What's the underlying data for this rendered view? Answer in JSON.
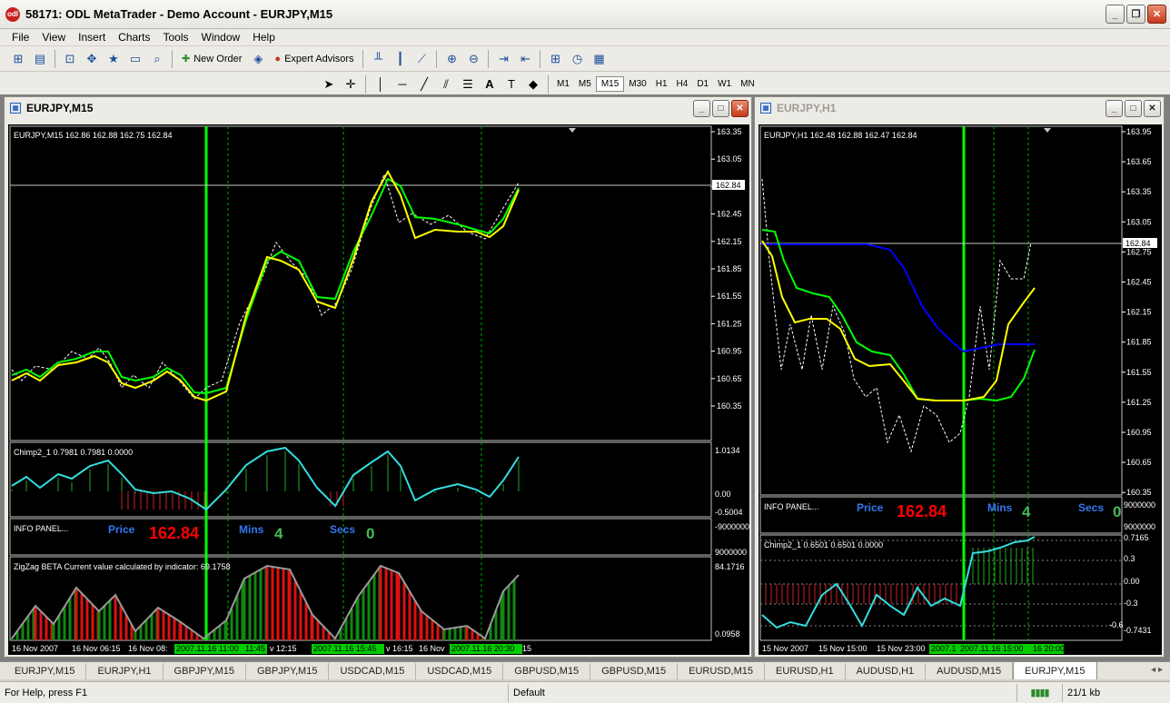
{
  "window": {
    "title": "58171: ODL MetaTrader - Demo Account - EURJPY,M15",
    "icon_label": "odl"
  },
  "menu": [
    "File",
    "View",
    "Insert",
    "Charts",
    "Tools",
    "Window",
    "Help"
  ],
  "toolbar": {
    "new_order": "New Order",
    "expert_advisors": "Expert Advisors"
  },
  "timeframes": [
    "M1",
    "M5",
    "M15",
    "M30",
    "H1",
    "H4",
    "D1",
    "W1",
    "MN"
  ],
  "active_timeframe": "M15",
  "chart1": {
    "title": "EURJPY,M15",
    "ohlc": "EURJPY,M15  162.86 162.88 162.75 162.84",
    "price_axis": [
      "163.35",
      "163.05",
      "162.75",
      "162.45",
      "162.15",
      "161.85",
      "161.55",
      "161.25",
      "160.95",
      "160.65",
      "160.35"
    ],
    "current_price": "162.84",
    "time_labels": [
      "16 Nov 2007",
      "16 Nov 06:15",
      "16 Nov 08:",
      "v 12:15",
      "v 16:15",
      "16 Nov"
    ],
    "time_markers": [
      "2007.11.16 11:00",
      "11:45",
      "2007.11.16 15:45",
      "2007.11.16 20:30",
      "15"
    ],
    "chimp_label": "Chimp2_1 0.7981 0.7981 0.0000",
    "chimp_axis": [
      "1.0134",
      "0.00",
      "-0.5004"
    ],
    "info_label": "INFO PANEL...",
    "info_price_label": "Price",
    "info_price_value": "162.84",
    "info_mins_label": "Mins",
    "info_mins_value": "4",
    "info_secs_label": "Secs",
    "info_secs_value": "0",
    "info_axis": [
      "-9000000",
      "9000000"
    ],
    "zigzag_label": "ZigZag BETA Current value calculated by indicator: 69.1758",
    "zigzag_axis": [
      "84.1716",
      "0.0958"
    ]
  },
  "chart2": {
    "title": "EURJPY,H1",
    "ohlc": "EURJPY,H1  162.48 162.88 162.47 162.84",
    "price_axis": [
      "163.95",
      "163.65",
      "163.35",
      "163.05",
      "162.75",
      "162.45",
      "162.15",
      "161.85",
      "161.55",
      "161.25",
      "160.95",
      "160.65",
      "160.35"
    ],
    "current_price": "162.84",
    "time_labels": [
      "15 Nov 2007",
      "15 Nov 15:00",
      "15 Nov 23:00"
    ],
    "time_markers": [
      "2007.1",
      "2007.11.16 15:00",
      "16 20:00"
    ],
    "info_label": "INFO PANEL...",
    "info_price_label": "Price",
    "info_price_value": "162.84",
    "info_mins_label": "Mins",
    "info_mins_value": "4",
    "info_secs_label": "Secs",
    "info_secs_value": "0",
    "info_axis": [
      "9000000",
      "9000000"
    ],
    "chimp_label": "Chimp2_1 0.6501 0.6501 0.0000",
    "chimp_axis": [
      "0.7165",
      "0.3",
      "0.00",
      "-0.3",
      "-0.6",
      "-0.7431"
    ]
  },
  "tabs": [
    "EURJPY,M15",
    "EURJPY,H1",
    "GBPJPY,M15",
    "GBPJPY,M15",
    "USDCAD,M15",
    "USDCAD,M15",
    "GBPUSD,M15",
    "GBPUSD,M15",
    "EURUSD,M15",
    "EURUSD,H1",
    "AUDUSD,H1",
    "AUDUSD,M15",
    "EURJPY,M15"
  ],
  "active_tab_index": 12,
  "status": {
    "help": "For Help, press F1",
    "profile": "Default",
    "traffic": "21/1 kb"
  },
  "colors": {
    "green_line": "#00ff00",
    "yellow_line": "#ffff00",
    "cyan_line": "#33dddd",
    "blue_line": "#0000ff",
    "price_red": "#ff0000",
    "label_blue": "#3377ee",
    "value_green": "#44bb55"
  }
}
